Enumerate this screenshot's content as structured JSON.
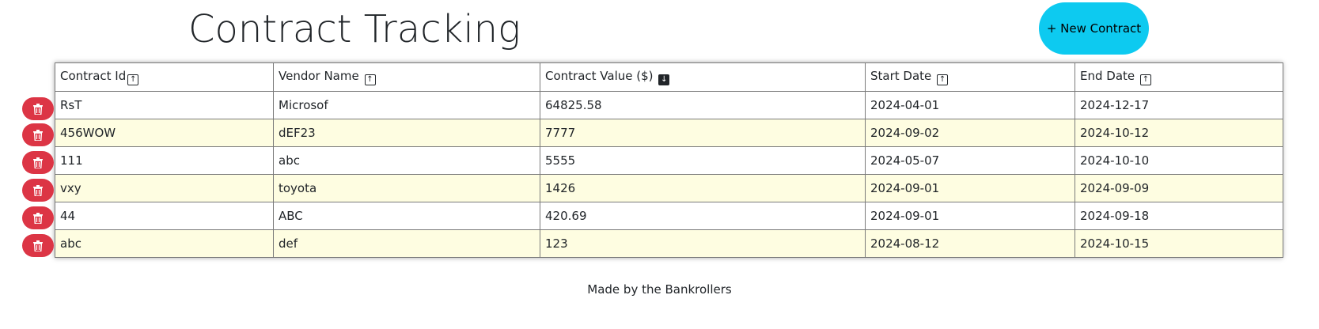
{
  "header": {
    "title": "Contract Tracking",
    "new_button_label": "+ New Contract"
  },
  "table": {
    "columns": [
      {
        "label": "Contract Id",
        "sort": "asc",
        "sort_icon": "arrow-up-icon"
      },
      {
        "label": "Vendor Name",
        "sort": "asc",
        "sort_icon": "arrow-up-icon"
      },
      {
        "label": "Contract Value ($)",
        "sort": "desc-active",
        "sort_icon": "arrow-down-icon"
      },
      {
        "label": "Start Date",
        "sort": "asc",
        "sort_icon": "arrow-up-icon"
      },
      {
        "label": "End Date",
        "sort": "asc",
        "sort_icon": "arrow-up-icon"
      }
    ],
    "rows": [
      [
        "RsT",
        "Microsof",
        "64825.58",
        "2024-04-01",
        "2024-12-17"
      ],
      [
        "456WOW",
        "dEF23",
        "7777",
        "2024-09-02",
        "2024-10-12"
      ],
      [
        "111",
        "abc",
        "5555",
        "2024-05-07",
        "2024-10-10"
      ],
      [
        "vxy",
        "toyota",
        "1426",
        "2024-09-01",
        "2024-09-09"
      ],
      [
        "44",
        "ABC",
        "420.69",
        "2024-09-01",
        "2024-09-18"
      ],
      [
        "abc",
        "def",
        "123",
        "2024-08-12",
        "2024-10-15"
      ]
    ],
    "delete_icon": "trash-icon"
  },
  "footer": {
    "text": "Made by the Bankrollers"
  },
  "colors": {
    "accent_button": "#0dcaf0",
    "delete_button": "#dc3545",
    "alt_row": "#fefde1"
  }
}
